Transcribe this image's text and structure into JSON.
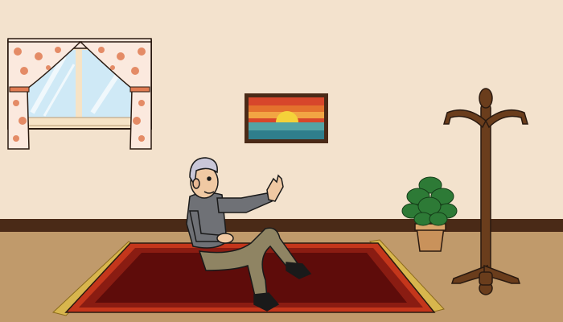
{
  "scene": {
    "colors": {
      "wall": "#f3e2cd",
      "baseboard": "#4a2a17",
      "floor": "#c09a6b",
      "rug_outer": "#c4361b",
      "rug_inner": "#8a1c12",
      "rug_core": "#5e0c0a",
      "fringe": "#d8b64d",
      "curtain": "#fbe9de",
      "curtain_flower": "#e07b52",
      "window_glass": "#cfe9f6",
      "window_frame": "#f6e3c6",
      "coat_rack": "#6a3d1c",
      "plant_leaf": "#2d7a36",
      "pot": "#c9925b",
      "shirt": "#6f7176",
      "pants": "#8f8463",
      "hair": "#c9c7d8",
      "skin": "#f0c9a3"
    },
    "painting": {
      "colors": [
        "#d7462b",
        "#e4712d",
        "#f2a543",
        "#53a3a5",
        "#2f7e8c",
        "#f4d23a"
      ]
    }
  }
}
